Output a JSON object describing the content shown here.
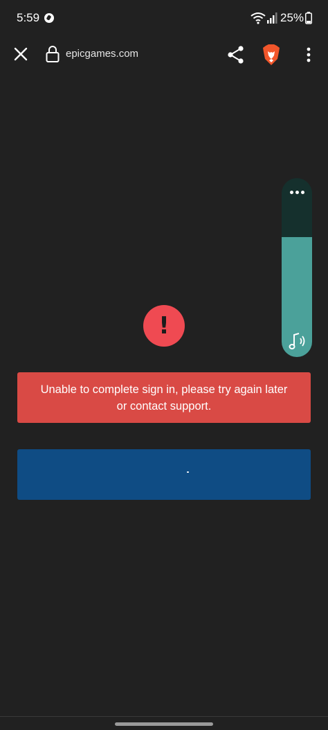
{
  "status_bar": {
    "time": "5:59",
    "battery_percent": "25%",
    "icons": [
      "notification-icon",
      "wifi-icon",
      "signal-icon",
      "battery-icon"
    ]
  },
  "browser": {
    "url": "epicgames.com",
    "icons": [
      "close-icon",
      "lock-icon",
      "share-icon",
      "brave-icon",
      "more-vert-icon"
    ]
  },
  "volume_panel": {
    "level": 0.67,
    "icons": [
      "more-horiz-icon",
      "media-volume-icon"
    ]
  },
  "error": {
    "icon_glyph": "!",
    "message": "Unable to complete sign in, please try again later or contact support."
  },
  "colors": {
    "background": "#212121",
    "error_red": "#d94a45",
    "error_icon": "#ef4a52",
    "button_blue": "#0f4c84",
    "volume_teal": "#4ba19a",
    "volume_track": "#15302d",
    "brave_orange": "#f1562b"
  }
}
